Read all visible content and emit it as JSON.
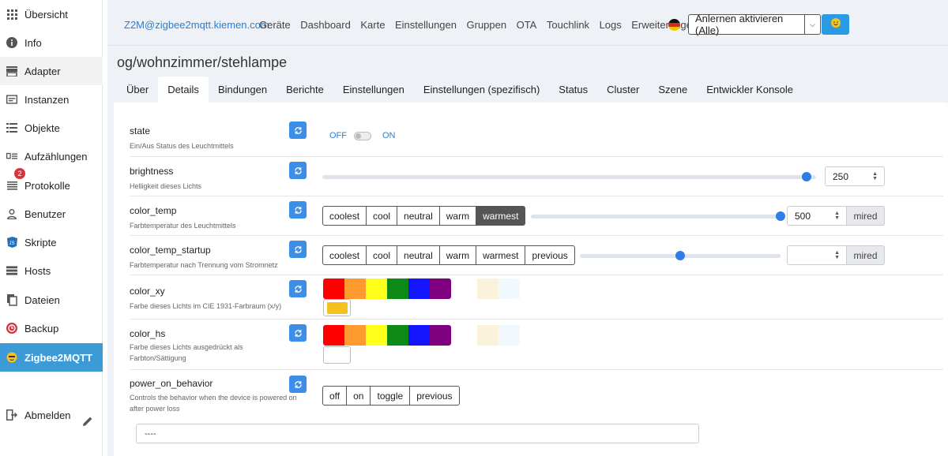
{
  "sidebar": {
    "items": [
      {
        "label": "Übersicht",
        "icon": "grid-icon"
      },
      {
        "label": "Info",
        "icon": "info-icon"
      },
      {
        "label": "Adapter",
        "icon": "store-icon"
      },
      {
        "label": "Instanzen",
        "icon": "instances-icon"
      },
      {
        "label": "Objekte",
        "icon": "list-icon"
      },
      {
        "label": "Aufzählungen",
        "icon": "enum-icon"
      },
      {
        "label": "Protokolle",
        "icon": "log-icon",
        "badge": "2"
      },
      {
        "label": "Benutzer",
        "icon": "user-icon"
      },
      {
        "label": "Skripte",
        "icon": "js-icon"
      },
      {
        "label": "Hosts",
        "icon": "server-icon"
      },
      {
        "label": "Dateien",
        "icon": "files-icon"
      },
      {
        "label": "Backup",
        "icon": "backup-icon"
      },
      {
        "label": "Zigbee2MQTT",
        "icon": "zigbee-icon"
      }
    ],
    "logout": "Abmelden",
    "edit_icon": "pencil-icon"
  },
  "header": {
    "brand": "Z2M@zigbee2mqtt.kiemen.com",
    "nav": [
      "Geräte",
      "Dashboard",
      "Karte",
      "Einstellungen",
      "Gruppen",
      "OTA",
      "Touchlink",
      "Logs",
      "Erweiterungen"
    ],
    "pair_button": "Anlernen aktivieren (Alle)"
  },
  "page": {
    "title": "og/wohnzimmer/stehlampe",
    "tabs": [
      "Über",
      "Details",
      "Bindungen",
      "Berichte",
      "Einstellungen",
      "Einstellungen (spezifisch)",
      "Status",
      "Cluster",
      "Szene",
      "Entwickler Konsole"
    ],
    "active_tab": "Details"
  },
  "exposes": {
    "state": {
      "name": "state",
      "desc": "Ein/Aus Status des Leuchtmittels",
      "off": "OFF",
      "on": "ON",
      "value": "OFF"
    },
    "brightness": {
      "name": "brightness",
      "desc": "Helligkeit dieses Lichts",
      "value": "250",
      "fraction": 0.98
    },
    "color_temp": {
      "name": "color_temp",
      "desc": "Farbtemperatur des Leuchtmittels",
      "presets": [
        "coolest",
        "cool",
        "neutral",
        "warm",
        "warmest"
      ],
      "selected": "warmest",
      "value": "500",
      "unit": "mired",
      "fraction": 1.0
    },
    "color_temp_startup": {
      "name": "color_temp_startup",
      "desc": "Farbtemperatur nach Trennung vom Stromnetz",
      "presets": [
        "coolest",
        "cool",
        "neutral",
        "warm",
        "warmest",
        "previous"
      ],
      "value": "",
      "unit": "mired",
      "fraction": 0.5
    },
    "color_xy": {
      "name": "color_xy",
      "desc": "Farbe dieses Lichts im CIE 1931-Farbraum (x/y)",
      "current": "#f6c11f"
    },
    "color_hs": {
      "name": "color_hs",
      "desc": "Farbe dieses Lichts ausgedrückt als Farbton/Sättigung",
      "current": "#ffffff"
    },
    "power_on_behavior": {
      "name": "power_on_behavior",
      "desc": "Controls the behavior when the device is powered on after power loss",
      "options": [
        "off",
        "on",
        "toggle",
        "previous"
      ]
    },
    "extra_input": "----"
  },
  "palette": [
    "#ff0000",
    "#ff9a2e",
    "#ffff1a",
    "#0d8a16",
    "#1414ff",
    "#7f007f"
  ],
  "palette_light": [
    "#ffffff",
    "#fbf2dc",
    "#f2f9fe"
  ],
  "colors": {
    "accent": "#2a7fd4",
    "active_sidebar": "#3c9bd6",
    "button_blue": "#3d8ee6",
    "badge": "#d9343b"
  }
}
